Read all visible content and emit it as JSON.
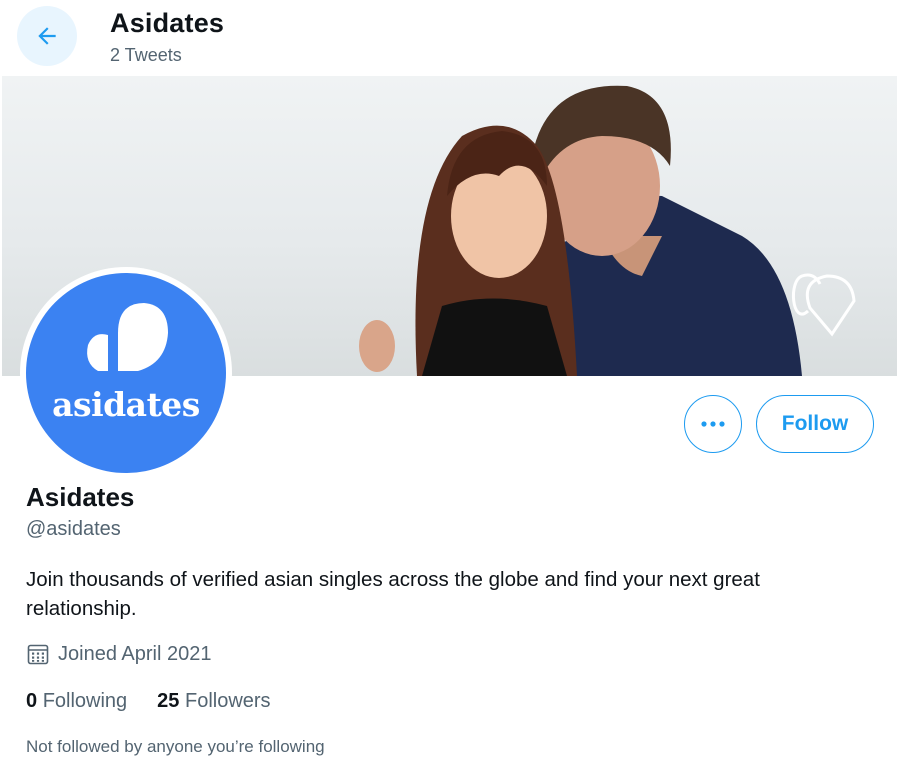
{
  "header": {
    "title": "Asidates",
    "tweet_count": "2 Tweets"
  },
  "avatar": {
    "logo_word": "asidates"
  },
  "actions": {
    "follow_label": "Follow"
  },
  "profile": {
    "name": "Asidates",
    "handle": "@asidates",
    "bio": "Join thousands of verified asian singles across the globe and find your next great relationship.",
    "joined": "Joined April 2021",
    "following_count": "0",
    "following_label": "Following",
    "followers_count": "25",
    "followers_label": "Followers",
    "followed_by_note": "Not followed by anyone you’re following"
  },
  "colors": {
    "accent": "#1d9bf0",
    "brand_blue": "#3b82f2",
    "secondary_text": "#536471"
  },
  "icons": [
    "arrow-left-icon",
    "more-icon",
    "calendar-icon",
    "heart-logo-icon"
  ]
}
